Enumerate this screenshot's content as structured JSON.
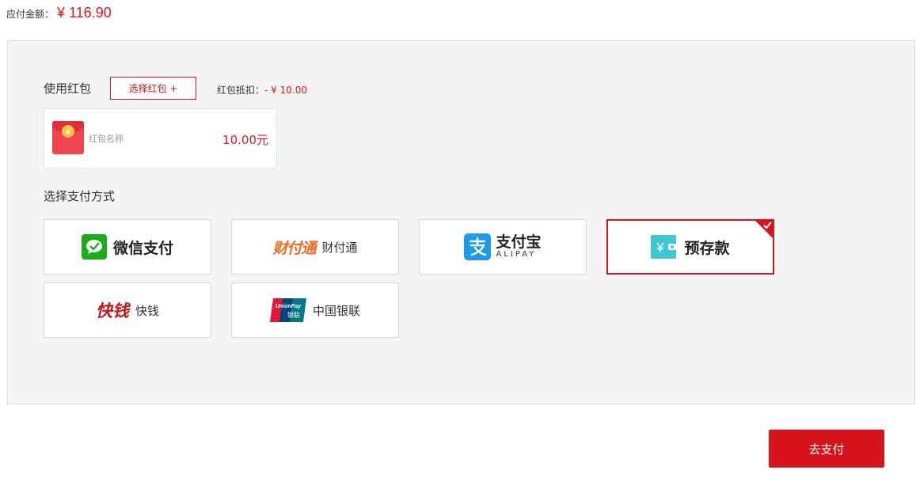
{
  "amount": {
    "label": "应付金额：",
    "value": "¥ 116.90"
  },
  "red_packet": {
    "title": "使用红包",
    "select_button": "选择红包 +",
    "deduct_label": "红包抵扣：",
    "deduct_value": "- ¥ 10.00",
    "card": {
      "name": "红包名称",
      "value": "10.00元",
      "icon": "red-envelope-icon"
    }
  },
  "payment": {
    "title": "选择支付方式",
    "options": [
      {
        "label": "微信支付",
        "icon": "wechat-pay-icon",
        "selected": false
      },
      {
        "label": "财付通",
        "logo_text": "财付通",
        "icon": "tenpay-logo",
        "selected": false
      },
      {
        "label": "支付宝",
        "sublabel": "ALIPAY",
        "icon": "alipay-icon",
        "selected": false
      },
      {
        "label": "预存款",
        "icon": "deposit-icon",
        "selected": true
      },
      {
        "label": "快钱",
        "logo_text": "快钱",
        "icon": "99bill-logo",
        "selected": false
      },
      {
        "label": "中国银联",
        "logo_text": "UnionPay 银联",
        "icon": "unionpay-logo",
        "selected": false
      }
    ]
  },
  "pay_button": "去支付",
  "colors": {
    "accent": "#d7141b",
    "price": "#e4151c",
    "wechat": "#1aad19",
    "alipay": "#1e9ae6",
    "deposit": "#3fc8d0"
  }
}
